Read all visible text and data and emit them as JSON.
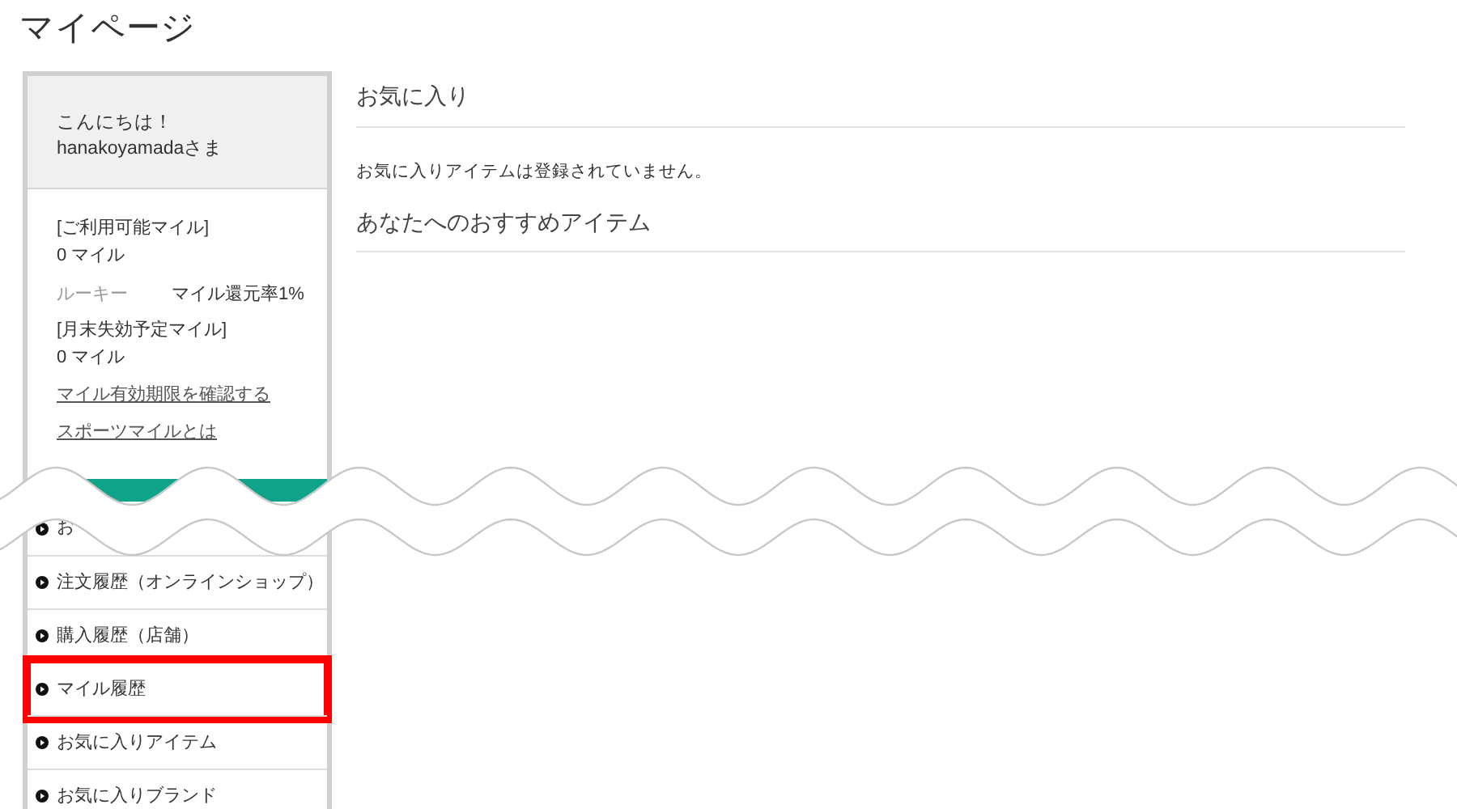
{
  "page_title": "マイページ",
  "sidebar": {
    "greeting": "こんにちは！",
    "user": "hanakoyamadaさま",
    "available_miles_label": "[ご利用可能マイル]",
    "available_miles": "0 マイル",
    "rank": "ルーキー",
    "return_rate": "マイル還元率1%",
    "expiring_miles_label": "[月末失効予定マイル]",
    "expiring_miles": "0 マイル",
    "links": [
      "マイル有効期限を確認する",
      "スポーツマイルとは"
    ],
    "menu": [
      {
        "label": "お",
        "highlighted": false
      },
      {
        "label": "注文履歴（オンラインショップ）",
        "highlighted": false
      },
      {
        "label": "購入履歴（店舗）",
        "highlighted": false
      },
      {
        "label": "マイル履歴",
        "highlighted": true
      },
      {
        "label": "お気に入りアイテム",
        "highlighted": false
      },
      {
        "label": "お気に入りブランド",
        "highlighted": false
      }
    ]
  },
  "main": {
    "sections": [
      {
        "heading": "お気に入り",
        "message": "お気に入りアイテムは登録されていません。"
      },
      {
        "heading": "あなたへのおすすめアイテム"
      }
    ]
  }
}
